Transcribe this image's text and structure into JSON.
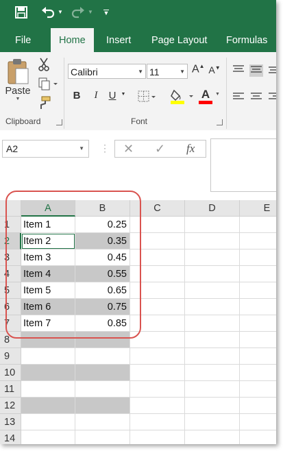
{
  "toolbar": {
    "save_icon": "save-icon",
    "undo_icon": "undo-icon",
    "redo_icon": "redo-icon",
    "customize_icon": "customize-qat-icon"
  },
  "tabs": [
    {
      "label": "File",
      "active": false
    },
    {
      "label": "Home",
      "active": true
    },
    {
      "label": "Insert",
      "active": false
    },
    {
      "label": "Page Layout",
      "active": false
    },
    {
      "label": "Formulas",
      "active": false
    }
  ],
  "ribbon": {
    "clipboard": {
      "paste_label": "Paste",
      "group_label": "Clipboard"
    },
    "font": {
      "font_name": "Calibri",
      "font_size": "11",
      "bold": "B",
      "italic": "I",
      "underline": "U",
      "grow_font": "A",
      "shrink_font": "A",
      "font_color_letter": "A",
      "group_label": "Font",
      "highlight_color": "#ffff00",
      "font_color": "#ff0000"
    }
  },
  "formula_bar": {
    "name_box": "A2",
    "cancel": "✕",
    "enter": "✓",
    "function": "fx",
    "value": ""
  },
  "grid": {
    "columns": [
      "A",
      "B",
      "C",
      "D",
      "E"
    ],
    "selected_column": "A",
    "rows": [
      {
        "num": "1",
        "a": "Item 1",
        "b": "0.25",
        "shaded": false
      },
      {
        "num": "2",
        "a": "Item 2",
        "b": "0.35",
        "shaded": true
      },
      {
        "num": "3",
        "a": "Item 3",
        "b": "0.45",
        "shaded": false
      },
      {
        "num": "4",
        "a": "Item 4",
        "b": "0.55",
        "shaded": true
      },
      {
        "num": "5",
        "a": "Item 5",
        "b": "0.65",
        "shaded": false
      },
      {
        "num": "6",
        "a": "Item 6",
        "b": "0.75",
        "shaded": true
      },
      {
        "num": "7",
        "a": "Item 7",
        "b": "0.85",
        "shaded": false
      },
      {
        "num": "8",
        "a": "",
        "b": "",
        "shaded": true
      },
      {
        "num": "9",
        "a": "",
        "b": "",
        "shaded": false
      },
      {
        "num": "10",
        "a": "",
        "b": "",
        "shaded": true
      },
      {
        "num": "11",
        "a": "",
        "b": "",
        "shaded": false
      },
      {
        "num": "12",
        "a": "",
        "b": "",
        "shaded": true
      },
      {
        "num": "13",
        "a": "",
        "b": "",
        "shaded": false
      },
      {
        "num": "14",
        "a": "",
        "b": "",
        "shaded": false
      }
    ],
    "active_cell": "A2"
  },
  "colors": {
    "excel_green": "#217346",
    "ribbon_bg": "#f3f3f3",
    "header_bg": "#e6e6e6",
    "shade": "#c8c8c8",
    "annotation": "#d9534f"
  }
}
